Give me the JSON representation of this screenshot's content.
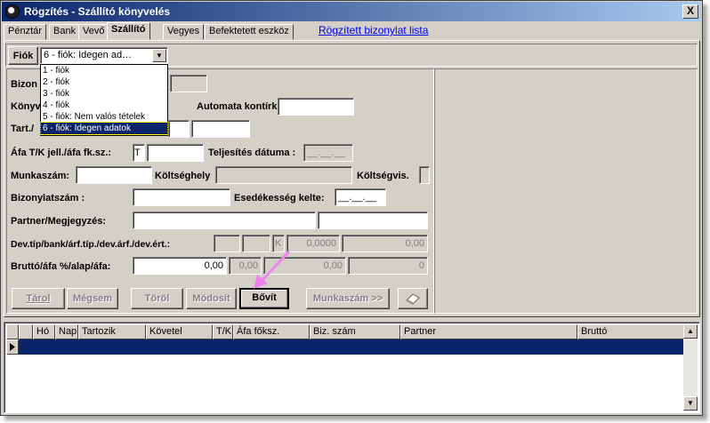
{
  "window": {
    "title": "Rögzítés - Szállító könyvelés",
    "close_label": "X"
  },
  "tabs": [
    "Pénztár",
    "Bank",
    "Vevő",
    "Szállító",
    "Vegyes",
    "Befektetett eszköz"
  ],
  "link": "Rögzített bizonylat lista",
  "fiok": {
    "button": "Fiók",
    "selected": "6 - fiók: Idegen ad…",
    "options": [
      "1 - fiók",
      "2 - fiók",
      "3 - fiók",
      "4 - fiók",
      "5 - fiók: Nem valós tételek",
      "6 - fiók: Idegen adatok"
    ]
  },
  "form": {
    "bizon_label": "Bizon",
    "konyv_label": "Könyv",
    "automata_label": "Automata kontírkód:",
    "tart_label": "Tart./",
    "afa_label": "Áfa T/K jell./áfa fk.sz.:",
    "afa_tk_value": "T",
    "teljesites_label": "Teljesítés dátuma :",
    "teljesites_value": "__.__.__",
    "munkaszam_label": "Munkaszám:",
    "koltseghely_label": "Költséghely",
    "koltsegvis_label": "Költségvis.",
    "bizonylatszam_label": "Bizonylatszám :",
    "esedekesseg_label": "Esedékesség kelte:",
    "esedekesseg_value": "__.__.__",
    "partner_label": "Partner/Megjegyzés:",
    "dev_label": "Dev.típ/bank/árf.típ./dev.árf./dev.ért.:",
    "dev_k": "K",
    "dev_arf": "0,0000",
    "dev_ert": "0,00",
    "brutto_label": "Bruttó/áfa %/alap/áfa:",
    "brutto_value": "0,00",
    "afa_pct_value": "0,00",
    "alap_value": "0,00",
    "afa_value": "0"
  },
  "buttons": {
    "tarol": "Tárol",
    "megsem": "Mégsem",
    "torol": "Töröl",
    "modosit": "Módosít",
    "bovit": "Bővít",
    "munkaszam": "Munkaszám >>",
    "eraser_icon": "eraser-icon"
  },
  "grid": {
    "headers": [
      "Hó",
      "Nap",
      "Tartozik",
      "Követel",
      "T/K",
      "Áfa főksz.",
      "Biz. szám",
      "Partner",
      "Bruttó"
    ]
  },
  "colors": {
    "title_bar": "#0a246a",
    "selection": "#0a246a",
    "annotation_arrow": "#ee82ee",
    "link": "#0000ee"
  }
}
